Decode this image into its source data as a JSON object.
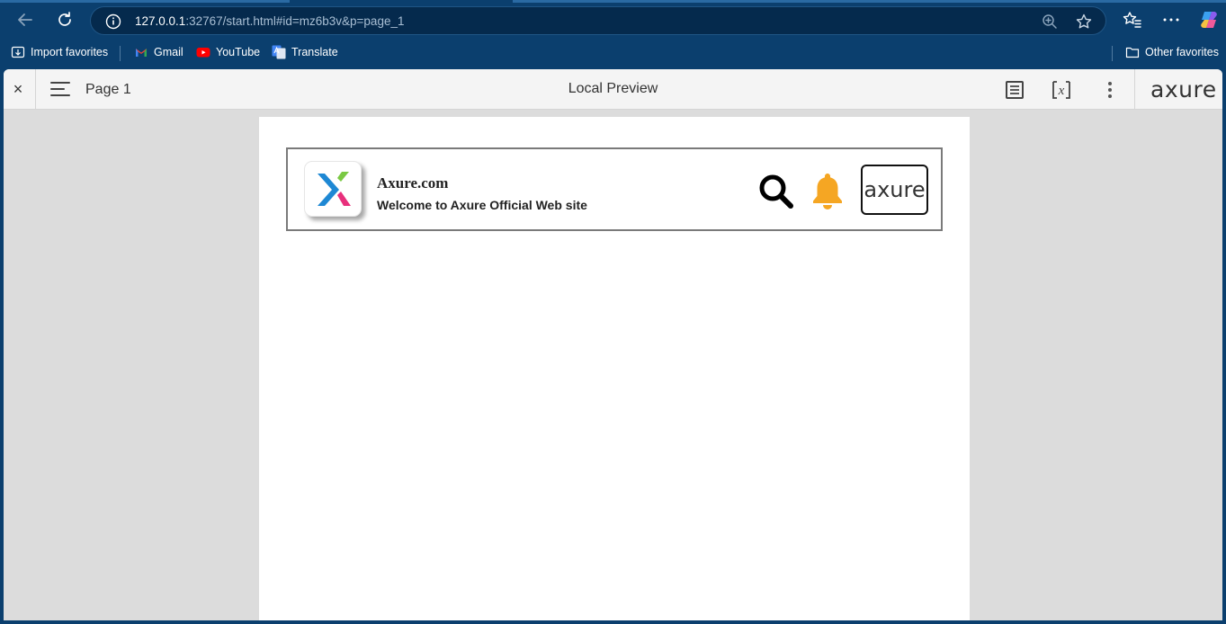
{
  "browser": {
    "url_host": "127.0.0.1",
    "url_rest": ":32767/start.html#id=mz6b3v&p=page_1",
    "favorites": [
      {
        "label": "Import favorites",
        "icon": "import-favorites-icon"
      },
      {
        "label": "Gmail",
        "icon": "gmail-icon"
      },
      {
        "label": "YouTube",
        "icon": "youtube-icon"
      },
      {
        "label": "Translate",
        "icon": "translate-icon"
      }
    ],
    "other_favorites": "Other favorites"
  },
  "axure_bar": {
    "close_glyph": "×",
    "page_label": "Page 1",
    "title": "Local Preview",
    "logo": "axure"
  },
  "page": {
    "site_name": "Axure.com",
    "tagline": "Welcome to Axure Official Web site",
    "logo_text": "axure"
  },
  "colors": {
    "browser_bg": "#0b3f6e",
    "bell": "#f5a623",
    "x_blue": "#1e88d4",
    "x_green": "#7ac943",
    "x_pink": "#e8307c"
  }
}
